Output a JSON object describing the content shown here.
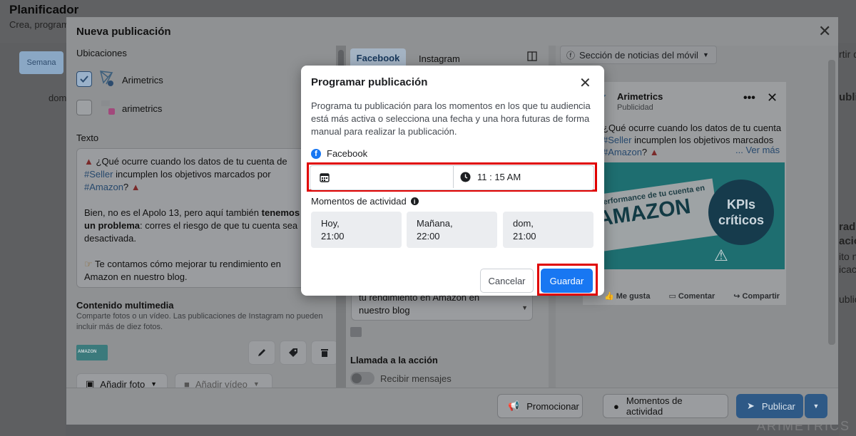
{
  "page": {
    "title": "Planificador",
    "subtitle": "Crea, program",
    "view_button": "Semana",
    "day_label": "dom",
    "watermark": "ARIMETRICS"
  },
  "under_right": {
    "line1": "rtir de",
    "line2": "ublic",
    "line3": "rad",
    "line4": "ació",
    "line5": "ito n",
    "line6": "icació",
    "line7": "ublic"
  },
  "modal": {
    "title": "Nueva publicación",
    "left": {
      "locations_label": "Ubicaciones",
      "accounts": [
        {
          "name": "Arimetrics",
          "checked": true
        },
        {
          "name": "arimetrics",
          "checked": false
        }
      ],
      "text_label": "Texto",
      "post": {
        "l1": "¿Qué ocurre cuando los datos de tu cuenta de",
        "l2_tag": "#Seller",
        "l2_rest": "incumplen los objetivos marcados por",
        "l3_tag": "#Amazon",
        "l3_rest": "?",
        "l4": "Bien, no es el Apolo 13, pero aquí también",
        "l4_bold": "tenemos",
        "l5_bold": "un problema",
        "l5_rest": ": corres el riesgo de que tu cuenta sea",
        "l6": "desactivada.",
        "l7": "Te contamos cómo mejorar tu rendimiento en",
        "l8": "Amazon en nuestro blog."
      },
      "media_label": "Contenido multimedia",
      "media_help_1": "Comparte fotos o un vídeo. Las publicaciones de Instagram no pueden",
      "media_help_2": "incluir más de diez fotos.",
      "add_photo": "Añadir foto",
      "add_video": "Añadir vídeo",
      "thumb_text": "AMAZON"
    },
    "middle": {
      "tabs": [
        "Facebook",
        "Instagram"
      ],
      "text_box_1": "tu rendimiento en Amazon en",
      "text_box_2": "nuestro blog",
      "cta_label": "Llamada a la acción",
      "cta_toggle": "Recibir mensajes"
    },
    "right": {
      "placement": "Sección de noticias del móvil",
      "page_name": "Arimetrics",
      "sponsored": "Publicidad",
      "preview_l1": "¿Qué ocurre cuando los datos de tu cuenta",
      "preview_l2_tag": "#Seller",
      "preview_l2_rest": "incumplen los objetivos marcados",
      "preview_l3_tag": "#Amazon",
      "preview_l3_rest": "?",
      "see_more": "... Ver más",
      "banner_line1": "erformance de tu cuenta en",
      "banner_line2": "AMAZON",
      "kpi_1": "KPIs",
      "kpi_2": "críticos",
      "like": "Me gusta",
      "comment": "Comentar",
      "share": "Compartir"
    },
    "footer": {
      "promote": "Promocionar",
      "moments": "Momentos de actividad",
      "publish": "Publicar"
    }
  },
  "dialog": {
    "title": "Programar publicación",
    "desc_1": "Programa tu publicación para los momentos en los que tu audiencia",
    "desc_2": "está más activa o selecciona una fecha y una hora futuras de forma",
    "desc_3": "manual para realizar la publicación.",
    "network": "Facebook",
    "time": "11 : 15 AM",
    "moments_label": "Momentos de actividad",
    "slots": [
      {
        "day": "Hoy,",
        "time": "21:00"
      },
      {
        "day": "Mañana,",
        "time": "22:00"
      },
      {
        "day": "dom,",
        "time": "21:00"
      }
    ],
    "cancel": "Cancelar",
    "save": "Guardar"
  },
  "colors": {
    "accent": "#1877f2",
    "highlight": "#e00000",
    "overlay": "#8f9193"
  }
}
